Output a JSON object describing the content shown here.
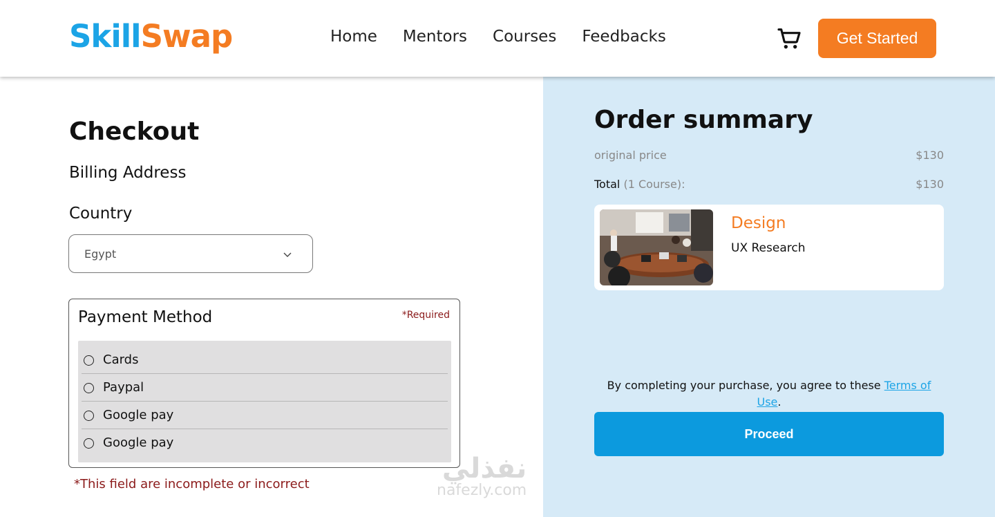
{
  "brand": {
    "part1": "Skill",
    "part2": "Swap"
  },
  "nav": {
    "items": [
      "Home",
      "Mentors",
      "Courses",
      "Feedbacks"
    ]
  },
  "header": {
    "cart_icon": "cart-icon",
    "cta_label": "Get Started"
  },
  "checkout": {
    "title": "Checkout",
    "billing_heading": "Billing Address",
    "country_label": "Country",
    "country_value": "Egypt",
    "payment": {
      "title": "Payment Method",
      "required": "*Required",
      "options": [
        "Cards",
        "Paypal",
        "Google pay",
        "Google pay"
      ]
    },
    "error": "*This field are incomplete or incorrect"
  },
  "summary": {
    "title": "Order summary",
    "original_label": "original price",
    "original_value": "$130",
    "total_label": "Total",
    "total_count": "(1 Course):",
    "total_value": "$130",
    "course": {
      "category": "Design",
      "name": "UX Research"
    },
    "terms_text": "By completing your purchase, you agree to these ",
    "terms_link": "Terms of Use",
    "terms_end": ".",
    "proceed_label": "Proceed"
  },
  "watermark": {
    "arabic": "نفذلي",
    "latin": "nafezly.com"
  },
  "colors": {
    "brand_blue": "#1ca4e6",
    "brand_orange": "#f47c22",
    "proceed_blue": "#0c9ade",
    "panel_bg": "#d6eaf7",
    "error_red": "#8b1a1a"
  }
}
